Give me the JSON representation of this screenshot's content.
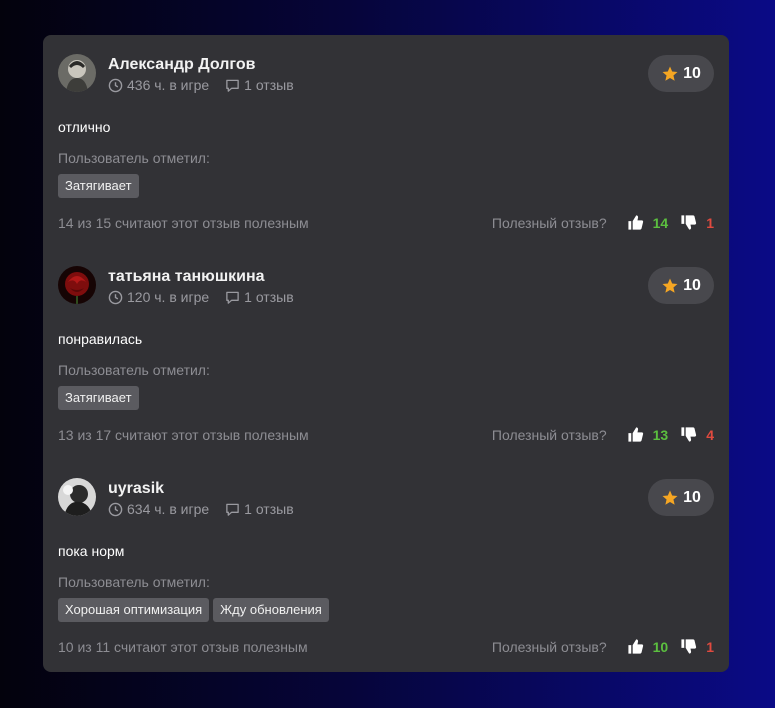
{
  "reviews": [
    {
      "author": "Александр Долгов",
      "hours": "436 ч. в игре",
      "review_count": "1 отзыв",
      "rating": "10",
      "text": "отлично",
      "tagged_label": "Пользователь отметил:",
      "tags": [
        "Затягивает"
      ],
      "helpful_text": "14 из 15 считают этот отзыв полезным",
      "helpful_question": "Полезный отзыв?",
      "likes": "14",
      "dislikes": "1"
    },
    {
      "author": "татьяна танюшкина",
      "hours": "120 ч. в игре",
      "review_count": "1 отзыв",
      "rating": "10",
      "text": "понравилась",
      "tagged_label": "Пользователь отметил:",
      "tags": [
        "Затягивает"
      ],
      "helpful_text": "13 из 17 считают этот отзыв полезным",
      "helpful_question": "Полезный отзыв?",
      "likes": "13",
      "dislikes": "4"
    },
    {
      "author": "uyrasik",
      "hours": "634 ч. в игре",
      "review_count": "1 отзыв",
      "rating": "10",
      "text": "пока норм",
      "tagged_label": "Пользователь отметил:",
      "tags": [
        "Хорошая оптимизация",
        "Жду обновления"
      ],
      "helpful_text": "10 из 11 считают этот отзыв полезным",
      "helpful_question": "Полезный отзыв?",
      "likes": "10",
      "dislikes": "1"
    }
  ],
  "colors": {
    "card": "#323236",
    "rating_pill": "#48484d",
    "star": "#f5a623",
    "like": "#5bbf3f",
    "dislike": "#e04a3f",
    "tag": "#5b5b60"
  },
  "icons": {
    "hours": "clock-icon",
    "reviews": "comment-icon",
    "rating": "star-icon",
    "like": "thumbs-up-icon",
    "dislike": "thumbs-down-icon"
  }
}
